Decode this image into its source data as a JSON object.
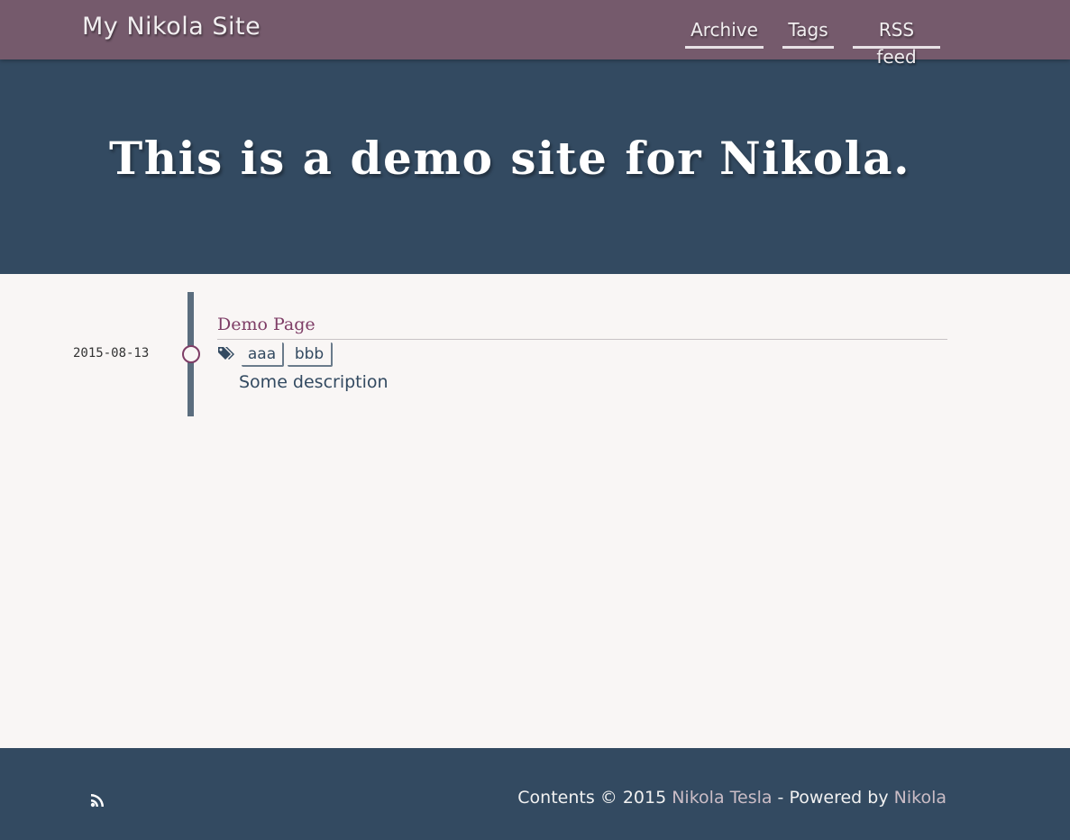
{
  "navbar": {
    "brand": "My Nikola Site",
    "links": [
      {
        "label": "Archive"
      },
      {
        "label": "Tags"
      },
      {
        "label": "RSS feed"
      }
    ]
  },
  "hero": {
    "title": "This is a demo site for Nikola."
  },
  "post": {
    "date": "2015-08-13",
    "title": "Demo Page",
    "tags": [
      "aaa",
      "bbb"
    ],
    "description": "Some description"
  },
  "footer": {
    "prefix": "Contents © 2015 ",
    "author": "Nikola Tesla",
    "middle": " - Powered by ",
    "engine": "Nikola"
  },
  "colors": {
    "navbar_bg": "#755a6c",
    "hero_bg": "#334a61",
    "accent": "#7e3d66",
    "page_bg": "#f9f6f5"
  }
}
